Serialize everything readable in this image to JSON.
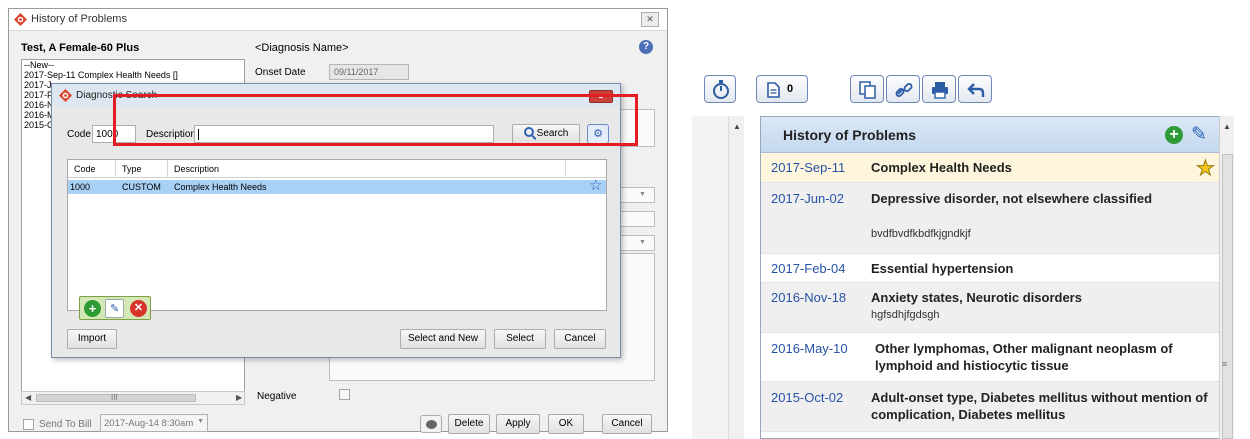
{
  "hop_dialog": {
    "title": "History of Problems",
    "close_glyph": "✕",
    "patient_name": "Test, A Female-60 Plus",
    "diagnosis_name_header": "<Diagnosis Name>",
    "help_glyph": "?",
    "problem_list": [
      "--New--",
      "2017-Sep-11 Complex Health Needs []",
      "2017-Ju",
      "2017-Fe",
      "2016-N",
      "2016-M",
      "2015-O"
    ],
    "scroll_grip": "III",
    "onset_label": "Onset Date",
    "onset_value": "09/11/2017",
    "negative_label": "Negative",
    "send_to_bill_label": "Send To Bill",
    "send_to_bill_date": "2017-Aug-14 8:30am",
    "buttons": {
      "delete": "Delete",
      "apply": "Apply",
      "ok": "OK",
      "cancel": "Cancel"
    }
  },
  "diag_search": {
    "title": "Diagnostic Search",
    "close_glyph": "▲",
    "code_label": "Code",
    "code_value": "1000",
    "description_label": "Description",
    "description_value": "",
    "search_button": "Search",
    "columns": [
      "Code",
      "Type",
      "Description"
    ],
    "rows": [
      {
        "code": "1000",
        "type": "CUSTOM",
        "description": "Complex Health Needs"
      }
    ],
    "buttons": {
      "import": "Import",
      "select_and_new": "Select and New",
      "select": "Select",
      "cancel": "Cancel"
    }
  },
  "right_panel": {
    "doc_count": "0",
    "panel_title": "History of Problems",
    "entries": [
      {
        "date": "2017-Sep-11",
        "diagnosis": "Complex Health Needs",
        "note": "",
        "favorite": true
      },
      {
        "date": "2017-Jun-02",
        "diagnosis": "Depressive disorder, not elsewhere classified",
        "note": "bvdfbvdfkbdfkjgndkjf",
        "favorite": false
      },
      {
        "date": "2017-Feb-04",
        "diagnosis": "Essential hypertension",
        "note": "",
        "favorite": false
      },
      {
        "date": "2016-Nov-18",
        "diagnosis": "Anxiety states, Neurotic disorders",
        "note": "hgfsdhjfgdsgh",
        "favorite": false
      },
      {
        "date": "2016-May-10",
        "diagnosis": "Other lymphomas, Other malignant neoplasm of lymphoid and histiocytic tissue",
        "note": "",
        "favorite": false
      },
      {
        "date": "2015-Oct-02",
        "diagnosis": "Adult-onset type, Diabetes mellitus without mention of complication, Diabetes mellitus",
        "note": "",
        "favorite": false
      }
    ]
  },
  "colors": {
    "highlight_border": "#e41c24",
    "selected_row": "#a9d0f5",
    "favorite_row": "#fdf6dc",
    "alt_row": "#efefef",
    "date_link": "#2752a6"
  }
}
